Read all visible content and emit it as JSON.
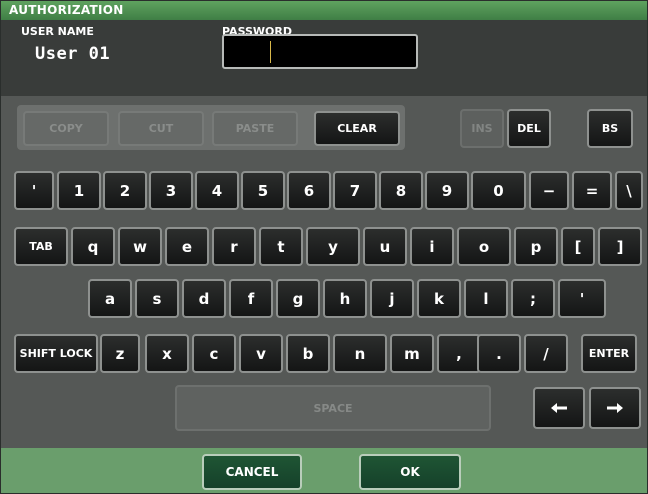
{
  "window": {
    "title": "AUTHORIZATION"
  },
  "user": {
    "label": "USER NAME",
    "value": "User 01"
  },
  "password": {
    "label": "PASSWORD",
    "value": ""
  },
  "edit_buttons": {
    "copy": "COPY",
    "cut": "CUT",
    "paste": "PASTE",
    "clear": "CLEAR",
    "ins": "INS",
    "del": "DEL",
    "bs": "BS"
  },
  "keys": {
    "row1": [
      "'",
      "1",
      "2",
      "3",
      "4",
      "5",
      "6",
      "7",
      "8",
      "9",
      "0",
      "−",
      "=",
      "\\"
    ],
    "row2": [
      "TAB",
      "q",
      "w",
      "e",
      "r",
      "t",
      "y",
      "u",
      "i",
      "o",
      "p",
      "[",
      "]"
    ],
    "row3": [
      "a",
      "s",
      "d",
      "f",
      "g",
      "h",
      "j",
      "k",
      "l",
      ";",
      "'"
    ],
    "row4": [
      "SHIFT LOCK",
      "z",
      "x",
      "c",
      "v",
      "b",
      "n",
      "m",
      ",",
      ".",
      "/",
      "ENTER"
    ],
    "space": "SPACE"
  },
  "footer": {
    "cancel": "CANCEL",
    "ok": "OK"
  },
  "colors": {
    "title_bar": "#4f9554",
    "footer": "#6a9e6c",
    "key_face": "#1e2020",
    "ok_button": "#1f5534"
  }
}
